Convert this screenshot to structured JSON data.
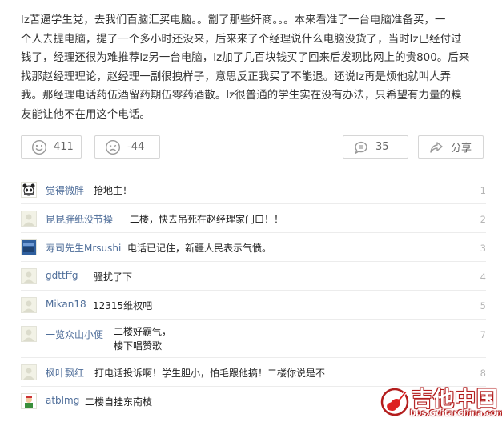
{
  "post": {
    "lines": [
      "lz苦逼学生党，去我们百脑汇买电脑。。劏了那些奸商。。。本来看准了一台电脑准备买，一",
      "个人去提电脑，提了一个多小时还没来，后来来了个经理说什么电脑没货了，当时lz已经付过",
      "钱了，经理还很为难推荐lz另一台电脑，lz加了几百块钱买了回来后发现比网上的贵800。后来",
      "找那赵经理理论，赵经理一副很拽样子，意思反正我买了不能退。还说lz再是烦他就叫人弄",
      "我。那经理电话药伍酒留药期伍零药酒散。lz很普通的学生实在没有办法，只希望有力量的糗",
      "友能让他不在用这个电话。"
    ]
  },
  "actions": {
    "like_count": "411",
    "dislike_count": "-44",
    "comment_count": "35",
    "share_label": "分享"
  },
  "replies": [
    {
      "user": "觉得微胖",
      "text": "抢地主！",
      "floor": "1",
      "avatar": "panda"
    },
    {
      "user": "昆昆胖纸没节操",
      "text": "二楼，快去吊死在赵经理家门口！！",
      "floor": "2",
      "avatar": "default"
    },
    {
      "user": "寿司先生Mrsushi",
      "text": "电话已记住，新疆人民表示气愤。",
      "floor": "3",
      "avatar": "blue"
    },
    {
      "user": "gdttffg",
      "text": "骚扰了下",
      "floor": "4",
      "avatar": "default"
    },
    {
      "user": "Mikan18",
      "text": "12315维权吧",
      "floor": "5",
      "avatar": "default"
    },
    {
      "user": "一览众山小便",
      "text": "二楼好霸气，\n楼下唱赞歌",
      "floor": "7",
      "avatar": "default"
    },
    {
      "user": "枫叶飘红",
      "text": "打电话投诉啊！学生胆小，怕毛跟他搞！二楼你说是不",
      "floor": "8",
      "avatar": "default"
    },
    {
      "user": "atblmg",
      "text": "二楼自挂东南枝",
      "floor": "9",
      "avatar": "cartoon"
    }
  ],
  "watermark": {
    "name": "吉他中国",
    "url": "bbs.GuitarChina.com"
  },
  "colors": {
    "username": "#4e6d99",
    "floor": "#b5b5b5",
    "watermark": "#b31d1d"
  }
}
